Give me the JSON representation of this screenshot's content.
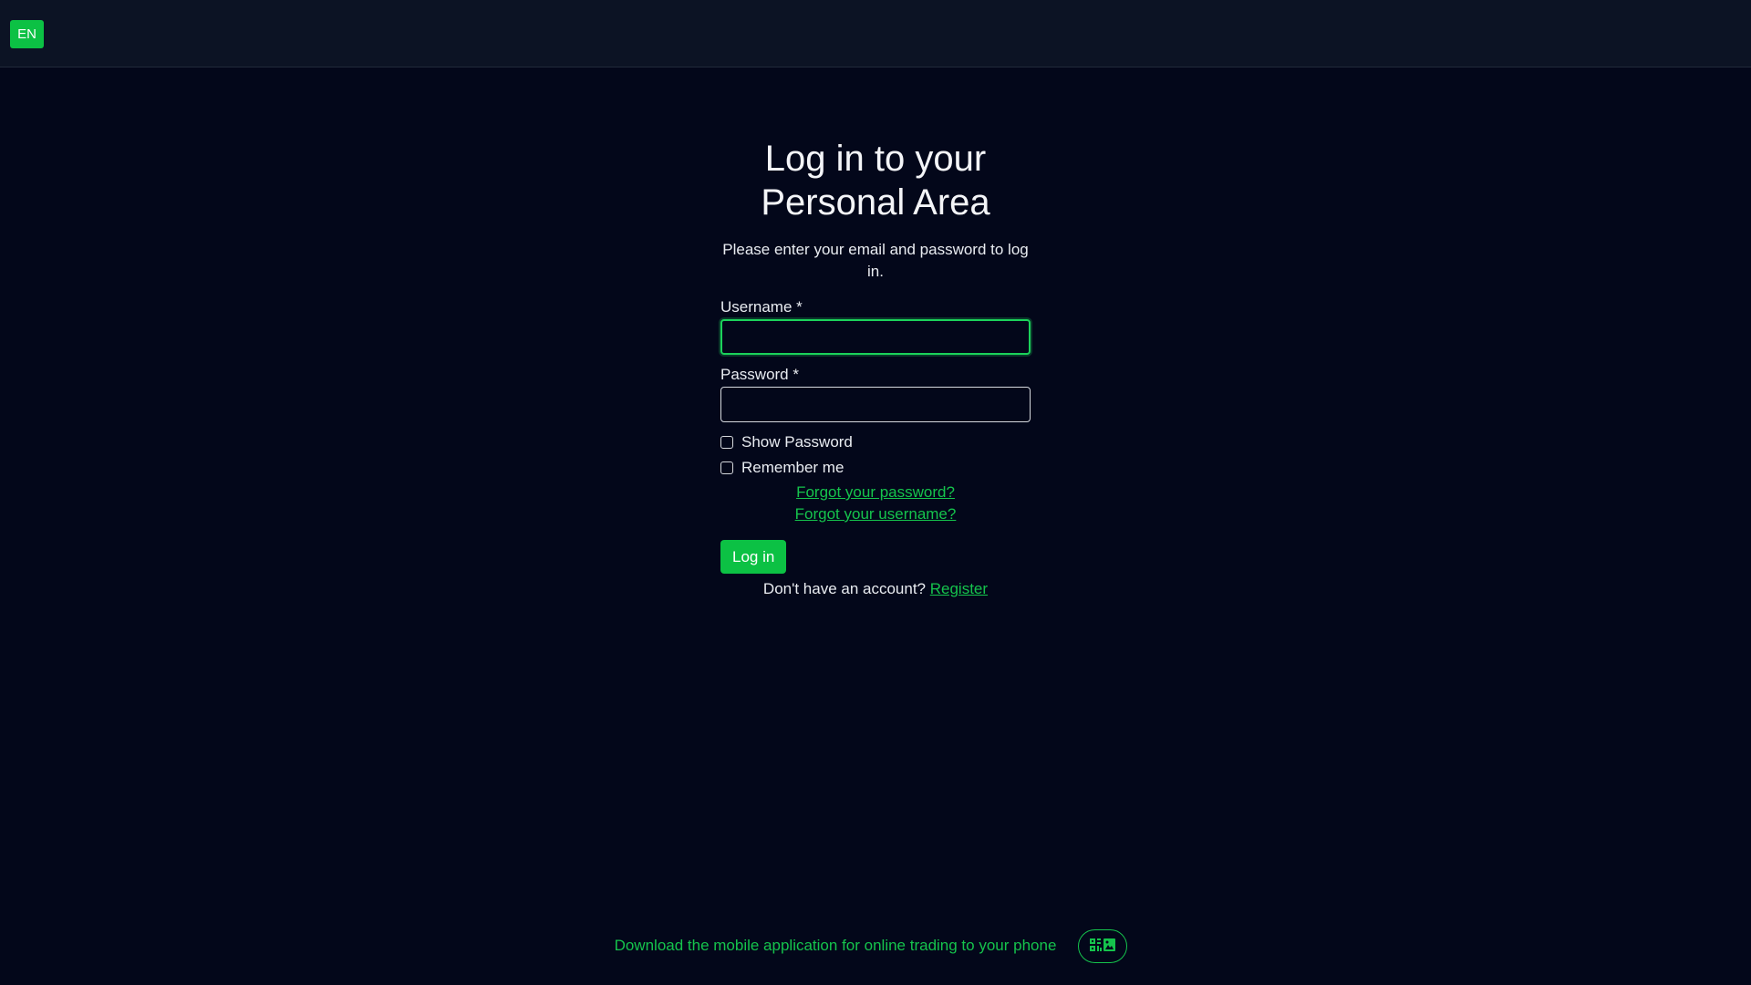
{
  "header": {
    "language_label": "EN"
  },
  "login": {
    "title_line1": "Log in to your",
    "title_line2": "Personal Area",
    "subtitle": "Please enter your email and password to log in.",
    "username_label": "Username *",
    "username_value": "",
    "password_label": "Password *",
    "password_value": "",
    "show_password_label": "Show Password",
    "remember_me_label": "Remember me",
    "forgot_password_link": "Forgot your password?",
    "forgot_username_link": "Forgot your username?",
    "login_button": "Log in",
    "no_account_text": "Don't have an account?",
    "register_link": "Register"
  },
  "footer": {
    "download_text": "Download the mobile application for online trading to your phone",
    "qr_icon": "qr-code-icon"
  },
  "colors": {
    "background": "#03071a",
    "header_background": "#0c1324",
    "accent": "#0cc144",
    "link": "#15c34c"
  }
}
